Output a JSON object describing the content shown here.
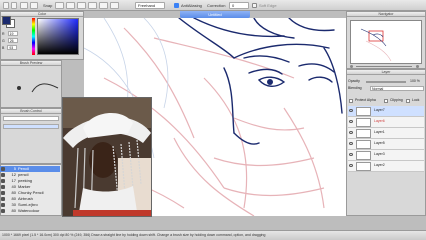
{
  "toolbar": {
    "snap_label": "Snap",
    "brush_mode": "Freehand",
    "antialiasing_label": "AntiAliasing",
    "correction_label": "Correction",
    "correction_value": "0",
    "soft_edge_label": "Soft Edge"
  },
  "document": {
    "tab_title": "Untitled"
  },
  "color_panel": {
    "title": "Color",
    "rgb": [
      {
        "label": "R",
        "value": "19"
      },
      {
        "label": "G",
        "value": "26"
      },
      {
        "label": "B",
        "value": "93"
      }
    ],
    "fg_color": "#1b2a6e",
    "bg_color": "#ffffff"
  },
  "brush_preview": {
    "title": "Brush Preview"
  },
  "brush_control": {
    "title": "Brush Control"
  },
  "brush_list": {
    "items": [
      {
        "size": "5",
        "name": "Pencil",
        "selected": true
      },
      {
        "size": "12",
        "name": "pencil",
        "selected": false
      },
      {
        "size": "17",
        "name": "peeking",
        "selected": false
      },
      {
        "size": "40",
        "name": "Marker",
        "selected": false
      },
      {
        "size": "80",
        "name": "Chunky Pencil",
        "selected": false
      },
      {
        "size": "80",
        "name": "Airbrush",
        "selected": false
      },
      {
        "size": "30",
        "name": "Sumi-e(bro",
        "selected": false
      },
      {
        "size": "80",
        "name": "Watercolour",
        "selected": false
      }
    ]
  },
  "navigator": {
    "title": "Navigator"
  },
  "layers": {
    "title": "Layer",
    "opacity_label": "Opacity",
    "opacity_value": "100 %",
    "blending_label": "Blending",
    "blending_value": "Normal",
    "protect_alpha_label": "Protect Alpha",
    "clipping_label": "Clipping",
    "lock_label": "Lock",
    "items": [
      {
        "name": "Layer7",
        "selected": true
      },
      {
        "name": "Layer6",
        "selected": false
      },
      {
        "name": "Layer1",
        "selected": false
      },
      {
        "name": "Layer5",
        "selected": false
      },
      {
        "name": "Layer3",
        "selected": false
      },
      {
        "name": "Layer2",
        "selected": false
      }
    ]
  },
  "status": {
    "text": "1000 * 1669 pixel   (1.5 * 16.0cm)   300 dpi   80 %   (249, 356)   Draw a straight line by holding down shift. Change a brush size by holding down command, option, and dragging"
  },
  "icons": {
    "eye": "eye-icon",
    "brush": "brush-icon"
  }
}
